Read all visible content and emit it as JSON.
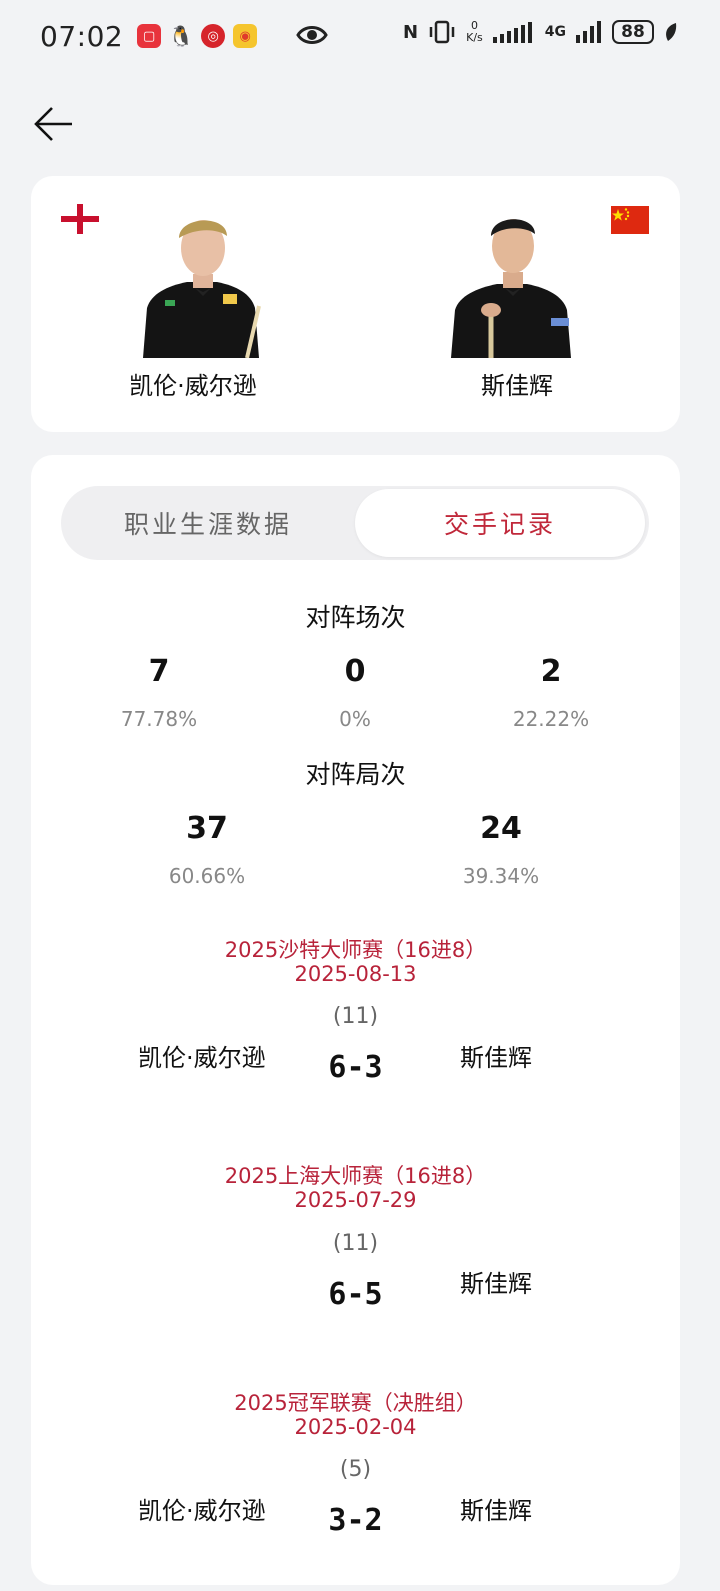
{
  "status": {
    "time": "07:02",
    "nfc": "N",
    "speed_value": "0",
    "speed_unit": "K/s",
    "network": "4G",
    "battery": "88"
  },
  "players": {
    "left": {
      "name": "凯伦·威尔逊",
      "flag": "england-flag"
    },
    "right": {
      "name": "斯佳辉",
      "flag": "china-flag"
    }
  },
  "tabs": {
    "career": "职业生涯数据",
    "h2h": "交手记录",
    "active": "h2h"
  },
  "matches_stats": {
    "title": "对阵场次",
    "left_value": "7",
    "left_pct": "77.78%",
    "draw_value": "0",
    "draw_pct": "0%",
    "right_value": "2",
    "right_pct": "22.22%"
  },
  "frames_stats": {
    "title": "对阵局次",
    "left_value": "37",
    "left_pct": "60.66%",
    "right_value": "24",
    "right_pct": "39.34%"
  },
  "records": [
    {
      "event": "2025沙特大师赛（16进8）",
      "date": "2025-08-13",
      "best_of": "(11)",
      "left": "凯伦·威尔逊",
      "right": "斯佳辉",
      "score": "6-3"
    },
    {
      "event": "2025上海大师赛（16进8）",
      "date": "2025-07-29",
      "best_of": "(11)",
      "left": "",
      "right": "斯佳辉",
      "score": "6-5"
    },
    {
      "event": "2025冠军联赛（决胜组）",
      "date": "2025-02-04",
      "best_of": "(5)",
      "left": "凯伦·威尔逊",
      "right": "斯佳辉",
      "score": "3-2"
    }
  ],
  "colors": {
    "accent": "#c0283a",
    "background": "#f2f3f5",
    "card": "#ffffff"
  }
}
